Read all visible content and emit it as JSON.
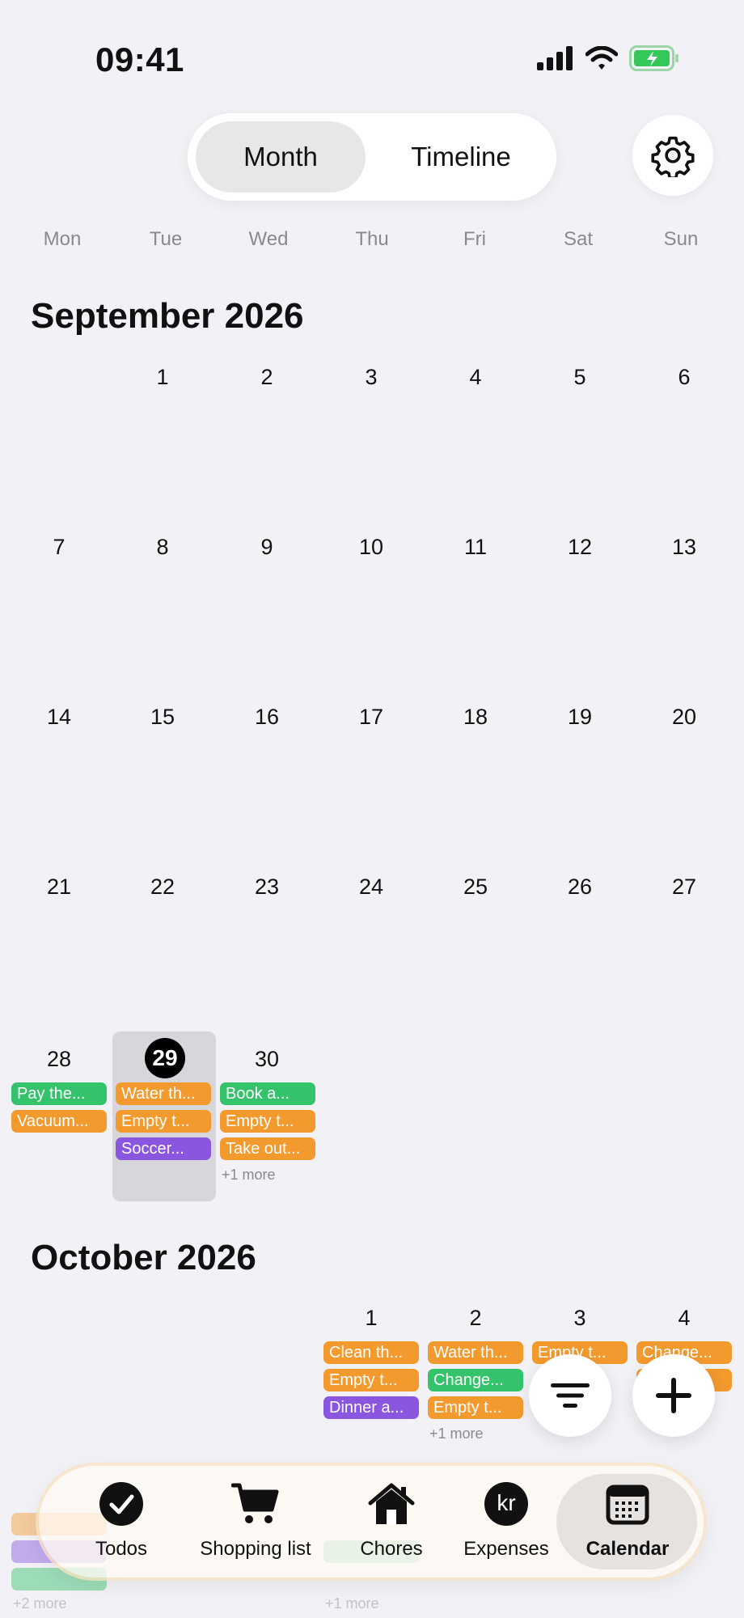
{
  "status": {
    "time": "09:41"
  },
  "view_switch": {
    "month": "Month",
    "timeline": "Timeline"
  },
  "weekdays": [
    "Mon",
    "Tue",
    "Wed",
    "Thu",
    "Fri",
    "Sat",
    "Sun"
  ],
  "september": {
    "title": "September 2026",
    "rows": [
      [
        "",
        "1",
        "2",
        "3",
        "4",
        "5",
        "6"
      ],
      [
        "7",
        "8",
        "9",
        "10",
        "11",
        "12",
        "13"
      ],
      [
        "14",
        "15",
        "16",
        "17",
        "18",
        "19",
        "20"
      ],
      [
        "21",
        "22",
        "23",
        "24",
        "25",
        "26",
        "27"
      ],
      [
        "28",
        "29",
        "30",
        "",
        "",
        "",
        ""
      ]
    ],
    "today": "29",
    "events": {
      "mon28": [
        "Pay the...",
        "Vacuum..."
      ],
      "tue29": [
        "Water th...",
        "Empty t...",
        "Soccer..."
      ],
      "wed30": [
        "Book a...",
        "Empty t...",
        "Take out..."
      ],
      "wed30_more": "+1 more"
    }
  },
  "october": {
    "title": "October 2026",
    "days": [
      "1",
      "2",
      "3",
      "4"
    ],
    "events": {
      "thu1": [
        "Clean th...",
        "Empty t...",
        "Dinner a..."
      ],
      "fri2": [
        "Water th...",
        "Change...",
        "Empty t..."
      ],
      "fri2_more": "+1 more",
      "sat3": [
        "Empty t..."
      ],
      "sun4": [
        "Change..."
      ]
    },
    "hidden_more": [
      "+2 more",
      "+1 more"
    ]
  },
  "tabs": {
    "todos": "Todos",
    "shopping": "Shopping list",
    "chores": "Chores",
    "expenses": "Expenses",
    "expenses_badge": "kr",
    "calendar": "Calendar"
  },
  "colors": {
    "orange": "#f39a2e",
    "green": "#34c26a",
    "purple": "#8a55df",
    "battery": "#34c759"
  },
  "icons": [
    "signal-icon",
    "wifi-icon",
    "battery-icon",
    "gear-icon",
    "filter-icon",
    "plus-icon",
    "checkmark-icon",
    "cart-icon",
    "house-icon",
    "calendar-icon"
  ]
}
